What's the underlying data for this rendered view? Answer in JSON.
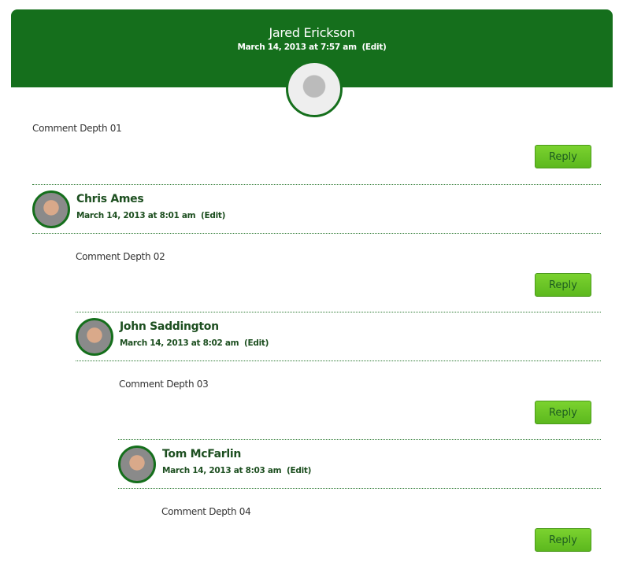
{
  "root": {
    "author": "Jared Erickson",
    "date": "March 14, 2013 at 7:57 am",
    "edit": "(Edit)",
    "text": "Comment Depth 01",
    "reply": "Reply"
  },
  "replies": [
    {
      "author": "Chris Ames",
      "date": "March 14, 2013 at 8:01 am",
      "edit": "(Edit)",
      "text": "Comment Depth 02",
      "reply": "Reply"
    },
    {
      "author": "John Saddington",
      "date": "March 14, 2013 at 8:02 am",
      "edit": "(Edit)",
      "text": "Comment Depth 03",
      "reply": "Reply"
    },
    {
      "author": "Tom McFarlin",
      "date": "March 14, 2013 at 8:03 am",
      "edit": "(Edit)",
      "text": "Comment Depth 04",
      "reply": "Reply"
    }
  ],
  "colors": {
    "header": "#156f1c",
    "button": "#6cc526"
  }
}
